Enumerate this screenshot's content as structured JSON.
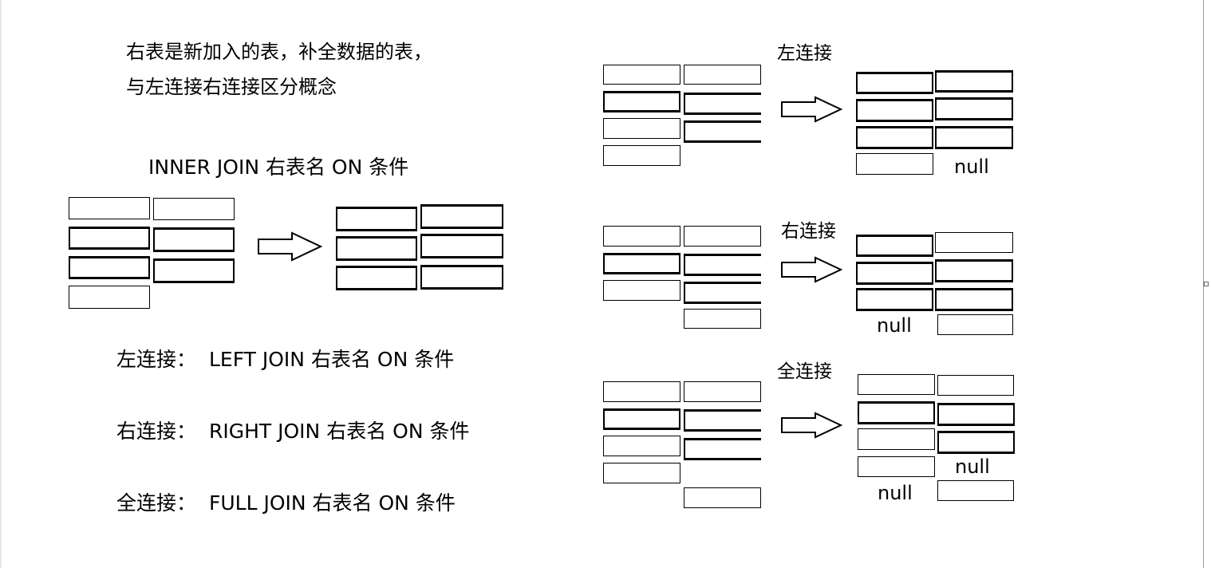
{
  "note": {
    "line1": "右表是新加入的表，补全数据的表，",
    "line2": "与左连接右连接区分概念"
  },
  "inner": {
    "label": "INNER JOIN 右表名 ON 条件"
  },
  "syntax": [
    {
      "name": "左连接：",
      "sql": "LEFT JOIN 右表名 ON 条件"
    },
    {
      "name": "右连接：",
      "sql": "RIGHT JOIN 右表名 ON 条件"
    },
    {
      "name": "全连接：",
      "sql": "FULL JOIN 右表名 ON 条件"
    }
  ],
  "diagrams": {
    "left": {
      "title": "左连接",
      "null_right": "null"
    },
    "right": {
      "title": "右连接",
      "null_left": "null"
    },
    "full": {
      "title": "全连接",
      "null_right": "null",
      "null_left": "null"
    }
  }
}
